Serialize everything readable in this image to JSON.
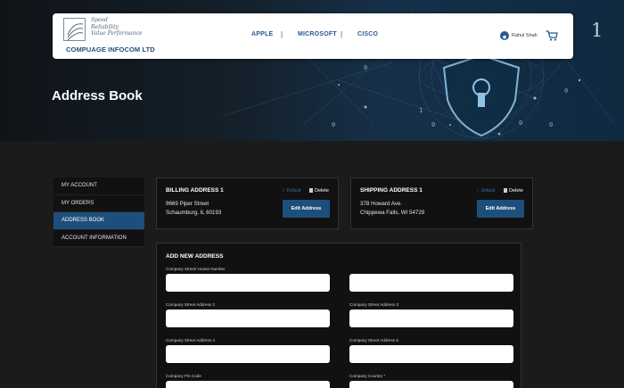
{
  "colors": {
    "accent": "#1d4f7c",
    "header_bg": "#ffffff",
    "page_bg": "#1b1b1b",
    "panel_bg": "#111111",
    "default_link": "#2f6eaa"
  },
  "header": {
    "logo_tagline": [
      "Speed",
      "Reliability",
      "Value Performance"
    ],
    "company_name": "COMPUAGE INFOCOM LTD",
    "nav": [
      "APPLE",
      "MICROSOFT",
      "CISCO"
    ],
    "separator": "|",
    "user_name": "Rahul Shah",
    "cart_icon": "cart-icon",
    "hero_numeral": "1"
  },
  "page": {
    "title": "Address Book"
  },
  "sidebar": {
    "items": [
      {
        "label": "MY ACCOUNT"
      },
      {
        "label": "MY ORDERS"
      },
      {
        "label": "ADDRESS BOOK"
      },
      {
        "label": "ACCOUNT INFORMATION"
      }
    ]
  },
  "billing": {
    "title": "BILLING ADDRESS 1",
    "line1": "9669 Piper Street",
    "line2": "Schaumburg, IL 60193",
    "default_label": "✓ Default",
    "delete_label": "Delete",
    "edit_label": "Edit Address"
  },
  "shipping": {
    "title": "SHIPPING ADDRESS 1",
    "line1": "378 Howard Ave.",
    "line2": "Chippewa Falls, WI 54729",
    "default_label": "✓ Default",
    "delete_label": "Delete",
    "edit_label": "Edit Address"
  },
  "add_address": {
    "title": "ADD NEW ADDRESS",
    "fields": [
      {
        "label": "Company Street/ House Number",
        "value": ""
      },
      {
        "label": "",
        "value": ""
      },
      {
        "label": "Company Street Address 2",
        "value": ""
      },
      {
        "label": "Company Street Address 3",
        "value": ""
      },
      {
        "label": "Company Street Address 4",
        "value": ""
      },
      {
        "label": "Company Street Address 5",
        "value": ""
      },
      {
        "label": "Company Pin Code",
        "value": ""
      },
      {
        "label": "Company Country *",
        "value": ""
      }
    ]
  }
}
